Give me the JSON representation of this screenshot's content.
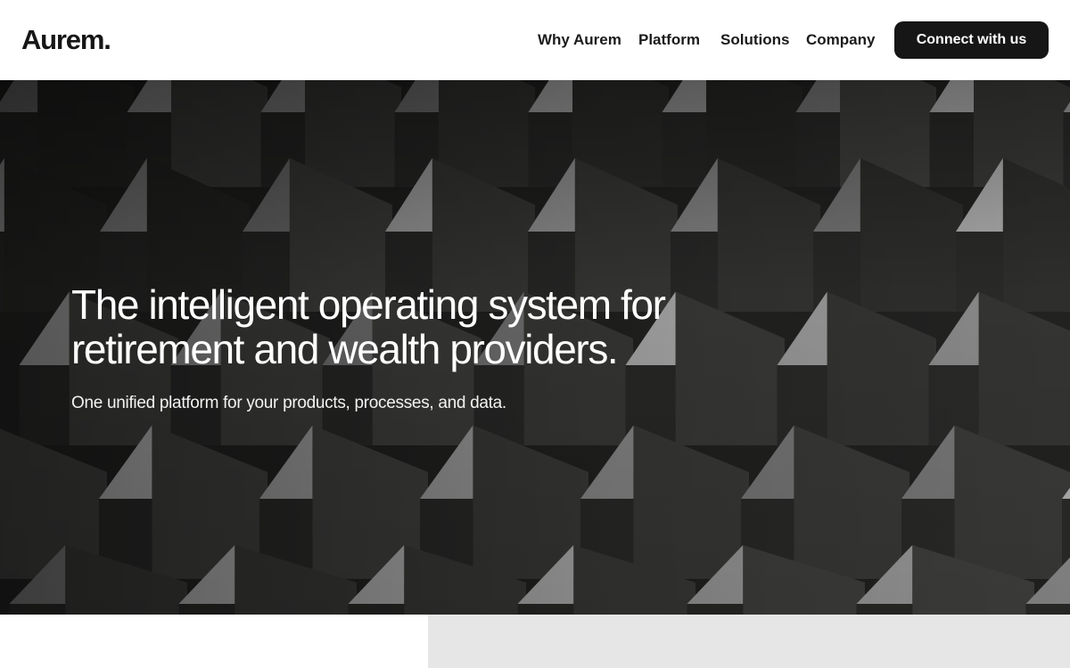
{
  "header": {
    "logo": "Aurem.",
    "nav": [
      "Why Aurem",
      "Platform",
      "Solutions",
      "Company"
    ],
    "cta_label": "Connect with us"
  },
  "hero": {
    "title_line1": "The intelligent operating system for",
    "title_line2": "retirement and wealth providers.",
    "subtitle": "One unified platform for your products, processes, and data.",
    "image_description_icon": "concrete-grid-background"
  },
  "colors": {
    "text": "#161616",
    "cta_bg": "#161616",
    "cta_text": "#ffffff",
    "hero_text": "#ffffff",
    "lower_panel": "#e6e6e6"
  }
}
